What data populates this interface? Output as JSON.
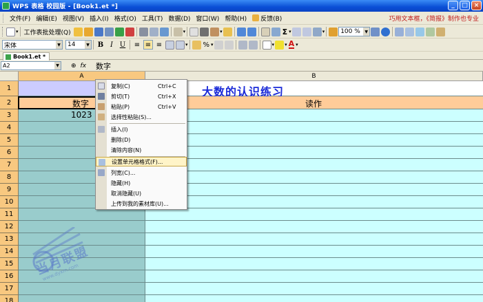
{
  "window": {
    "title": "WPS 表格 校园版 - [Book1.et *]",
    "buttons": {
      "minimize": "_",
      "maximize": "□",
      "close": "×"
    }
  },
  "menubar": {
    "items": [
      "文件(F)",
      "编辑(E)",
      "视图(V)",
      "插入(I)",
      "格式(O)",
      "工具(T)",
      "数据(D)",
      "窗口(W)",
      "帮助(H)"
    ],
    "feedback": "反馈(B)",
    "tip": "巧用文本框，《简报》制作也专业"
  },
  "toolbar1": {
    "quick_label": "工作表批处理(Q)",
    "zoom": "100 %"
  },
  "toolbar2": {
    "font": "宋体",
    "size": "14"
  },
  "tabs": [
    {
      "label": "Book1.et *"
    }
  ],
  "formula_bar": {
    "name_box": "A2",
    "fx": "fx",
    "content": "数字"
  },
  "grid": {
    "columns": [
      "A",
      "B"
    ],
    "rows": [
      "1",
      "2",
      "3",
      "4",
      "5",
      "6",
      "7",
      "8",
      "9",
      "10",
      "11",
      "12",
      "13",
      "14",
      "15",
      "16",
      "17",
      "18"
    ],
    "cells": {
      "B1": "大数的认识练习",
      "A2": "数字",
      "B2": "读作",
      "A3": "1023"
    }
  },
  "context_menu": {
    "items": [
      {
        "label": "复制(C)",
        "shortcut": "Ctrl+C"
      },
      {
        "label": "剪切(T)",
        "shortcut": "Ctrl+X"
      },
      {
        "label": "粘贴(P)",
        "shortcut": "Ctrl+V"
      },
      {
        "label": "选择性粘贴(S)...",
        "shortcut": ""
      },
      {
        "label": "插入(I)",
        "shortcut": ""
      },
      {
        "label": "删除(D)",
        "shortcut": ""
      },
      {
        "label": "清除内容(N)",
        "shortcut": ""
      },
      {
        "label": "设置单元格格式(F)...",
        "shortcut": ""
      },
      {
        "label": "列宽(C)...",
        "shortcut": ""
      },
      {
        "label": "隐藏(H)",
        "shortcut": ""
      },
      {
        "label": "取消隐藏(U)",
        "shortcut": ""
      },
      {
        "label": "上传到我的素材库(U)...",
        "shortcut": ""
      }
    ],
    "highlighted": "设置单元格格式(F)..."
  },
  "watermark": {
    "text": "当月联盟",
    "url": "www.dyxm.com"
  },
  "colors": {
    "title_blue": "#0a4fd6",
    "col_a": "#99cccc",
    "col_b": "#ccffff",
    "header_orange": "#ffcc99",
    "title_text": "#1a2ad8",
    "row_header": "#f8c880"
  }
}
